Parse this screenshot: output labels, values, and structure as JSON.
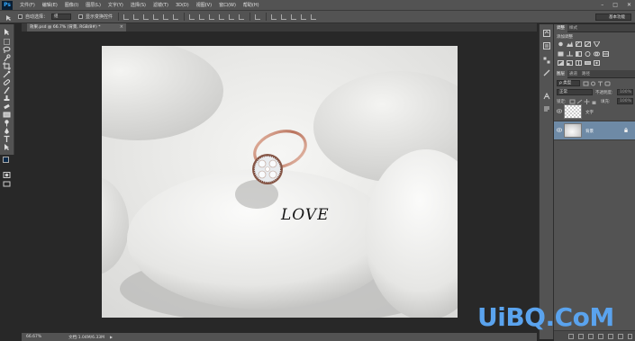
{
  "app": {
    "logo": "Ps"
  },
  "menubar": {
    "items": [
      {
        "label": "文件(F)"
      },
      {
        "label": "编辑(E)"
      },
      {
        "label": "图像(I)"
      },
      {
        "label": "图层(L)"
      },
      {
        "label": "文字(Y)"
      },
      {
        "label": "选择(S)"
      },
      {
        "label": "滤镜(T)"
      },
      {
        "label": "3D(D)"
      },
      {
        "label": "视图(V)"
      },
      {
        "label": "窗口(W)"
      },
      {
        "label": "帮助(H)"
      }
    ],
    "window_controls": [
      "–",
      "□",
      "✕"
    ]
  },
  "options": {
    "auto_select_label": "自动选择：",
    "auto_select_value": "组",
    "show_transform_label": "显示变换控件",
    "workspace_value": "基本功能"
  },
  "document": {
    "tab_label": "效果.psd @ 66.7% (背景, RGB/8#) *",
    "tab_close": "×"
  },
  "photo": {
    "text": "LOVE"
  },
  "status": {
    "zoom": "66.67%",
    "doc_size": "文档:1.04M/6.33M",
    "arrow": "▶"
  },
  "adjustments_panel": {
    "tabs": [
      "调整",
      "样式"
    ],
    "title": "添加调整"
  },
  "layers_panel": {
    "tabs": [
      "图层",
      "通道",
      "路径"
    ],
    "kind_filter": "ρ 类型",
    "blend_mode": "正常",
    "opacity_label": "不透明度:",
    "opacity_value": "100%",
    "lock_label": "锁定:",
    "fill_label": "填充:",
    "fill_value": "100%",
    "layers": [
      {
        "name": "文字",
        "selected": false
      },
      {
        "name": "背景",
        "selected": true
      }
    ]
  },
  "watermark": {
    "text": "UiBQ.CoM"
  },
  "colors": {
    "foreground": "#0b2a4a",
    "background": "#ffffff",
    "selected_layer": "#6e8aa6",
    "watermark": "#5aa3ee"
  }
}
